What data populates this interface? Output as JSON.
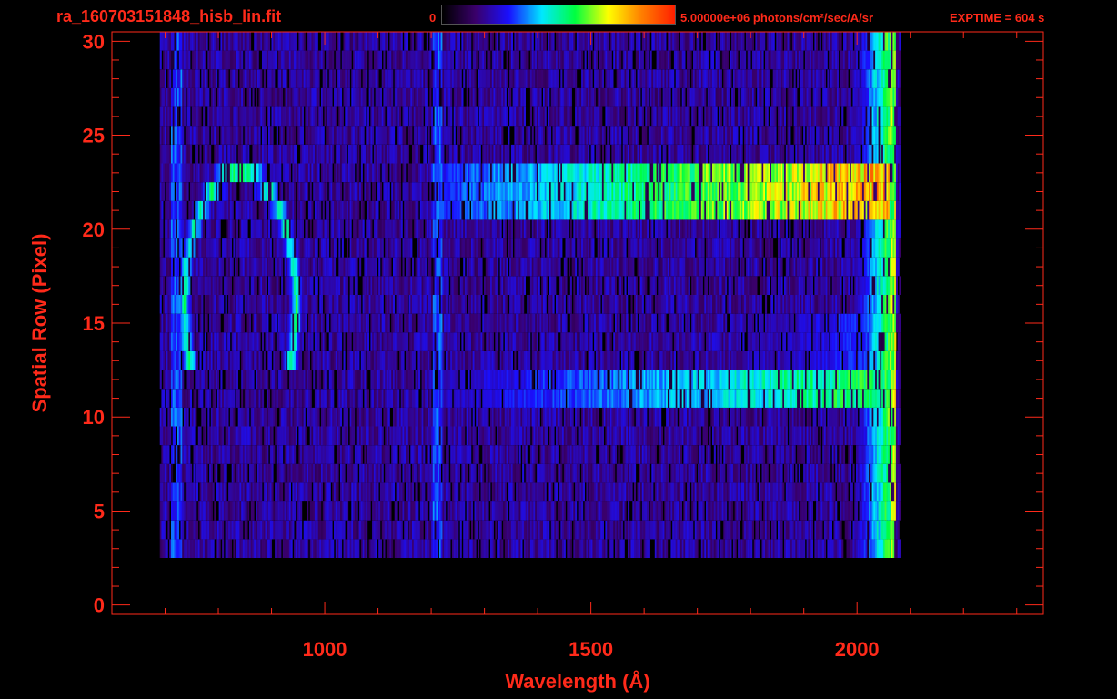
{
  "header": {
    "filename": "ra_160703151848_hisb_lin.fit",
    "colorbar_min": "0",
    "colorbar_max": "5.00000e+06 photons/cm²/sec/A/sr",
    "exptime": "EXPTIME = 604 s"
  },
  "chart_data": {
    "type": "heatmap",
    "xlabel": "Wavelength (Å)",
    "ylabel": "Spatial Row (Pixel)",
    "xlim": [
      600,
      2350
    ],
    "ylim": [
      -0.5,
      30.5
    ],
    "x_ticks": [
      1000,
      1500,
      2000
    ],
    "y_ticks": [
      0,
      5,
      10,
      15,
      20,
      25,
      30
    ],
    "colorbar": {
      "range": [
        0,
        5000000
      ],
      "units": "photons/cm²/sec/A/sr",
      "colors": [
        "#000000",
        "#3a006b",
        "#1a10ff",
        "#00e8ff",
        "#00ff40",
        "#ffff00",
        "#ff8000",
        "#ff2000"
      ]
    },
    "signal_rows": [
      3,
      30
    ],
    "features": [
      {
        "wavelength_range": [
          700,
          960
        ],
        "rows": [
          13,
          23
        ],
        "level": 0.55,
        "shape": "arc"
      },
      {
        "wavelength_range": [
          1200,
          2060
        ],
        "rows": [
          21,
          23
        ],
        "level": 0.85,
        "shape": "band"
      },
      {
        "wavelength_range": [
          1200,
          2060
        ],
        "rows": [
          11,
          12
        ],
        "level": 0.6,
        "shape": "band"
      },
      {
        "wavelength_range": [
          1700,
          2060
        ],
        "rows": [
          13,
          15
        ],
        "level": 0.35,
        "shape": "band"
      },
      {
        "wavelength_range": [
          1940,
          2070
        ],
        "rows": [
          3,
          30
        ],
        "level": 0.7,
        "shape": "edge"
      }
    ]
  }
}
